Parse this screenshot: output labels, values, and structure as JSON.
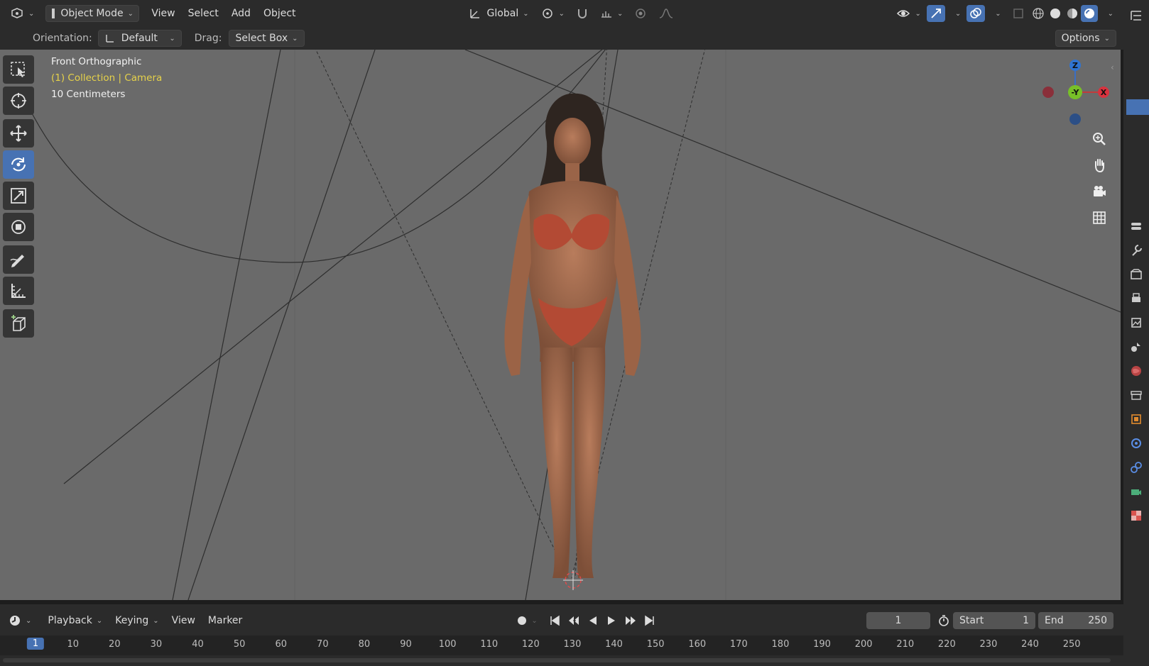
{
  "header": {
    "editor_type_icon": "3d-viewport-icon",
    "mode": "Object Mode",
    "menus": [
      "View",
      "Select",
      "Add",
      "Object"
    ],
    "transform_orientation": "Global"
  },
  "tool_header": {
    "orientation_label": "Orientation:",
    "orientation_value": "Default",
    "drag_label": "Drag:",
    "drag_value": "Select Box",
    "options_label": "Options"
  },
  "viewport": {
    "view_name": "Front Orthographic",
    "collection_line": "(1) Collection | Camera",
    "scale_line": "10 Centimeters",
    "gizmo": {
      "z": "Z",
      "y": "-Y",
      "x": "X"
    }
  },
  "toolbar_tools": [
    "select-box-icon",
    "cursor-icon",
    "move-icon",
    "rotate-icon",
    "scale-icon",
    "transform-icon",
    "annotate-icon",
    "measure-icon",
    "add-cube-icon"
  ],
  "active_tool": "rotate-icon",
  "timeline": {
    "menus": [
      "Playback",
      "Keying",
      "View",
      "Marker"
    ],
    "current_frame": "1",
    "start_label": "Start",
    "start_value": "1",
    "end_label": "End",
    "end_value": "250",
    "ruler": [
      "1",
      "10",
      "20",
      "30",
      "40",
      "50",
      "60",
      "70",
      "80",
      "90",
      "100",
      "110",
      "120",
      "130",
      "140",
      "150",
      "160",
      "170",
      "180",
      "190",
      "200",
      "210",
      "220",
      "230",
      "240",
      "250"
    ]
  },
  "colors": {
    "accent": "#4772b3",
    "collection_text": "#e6d24a",
    "viewport_bg": "#6a6a6a",
    "panel_bg": "#2b2b2b"
  }
}
